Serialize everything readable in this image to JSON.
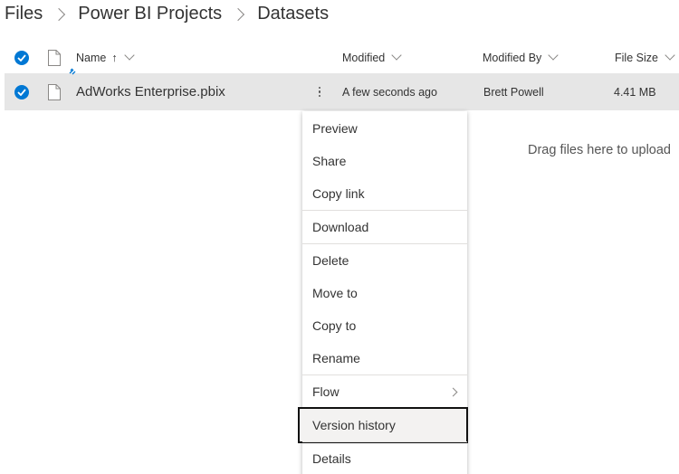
{
  "breadcrumb": {
    "items": [
      "Files",
      "Power BI Projects",
      "Datasets"
    ]
  },
  "columns": {
    "name": "Name",
    "name_sort_indicator": "↑",
    "modified": "Modified",
    "modified_by": "Modified By",
    "file_size": "File Size"
  },
  "file": {
    "name": "AdWorks Enterprise.pbix",
    "modified": "A few seconds ago",
    "modified_by": "Brett Powell",
    "size": "4.41 MB",
    "selected": true
  },
  "drop_hint": "Drag files here to upload",
  "context_menu": {
    "items": [
      "Preview",
      "Share",
      "Copy link",
      "Download",
      "Delete",
      "Move to",
      "Copy to",
      "Rename",
      "Flow",
      "Version history",
      "Details"
    ],
    "highlighted": "Version history"
  },
  "colors": {
    "accent": "#0078d4",
    "row_selected": "#e6e6e6",
    "highlight_border": "#111111"
  },
  "icons": {
    "select_all": "checkmark-circle-icon",
    "file_type": "document-icon",
    "row_select": "checkmark-circle-icon",
    "more": "more-vertical-icon",
    "new_file": "new-file-sparkle-icon",
    "submenu": "chevron-right-icon"
  }
}
